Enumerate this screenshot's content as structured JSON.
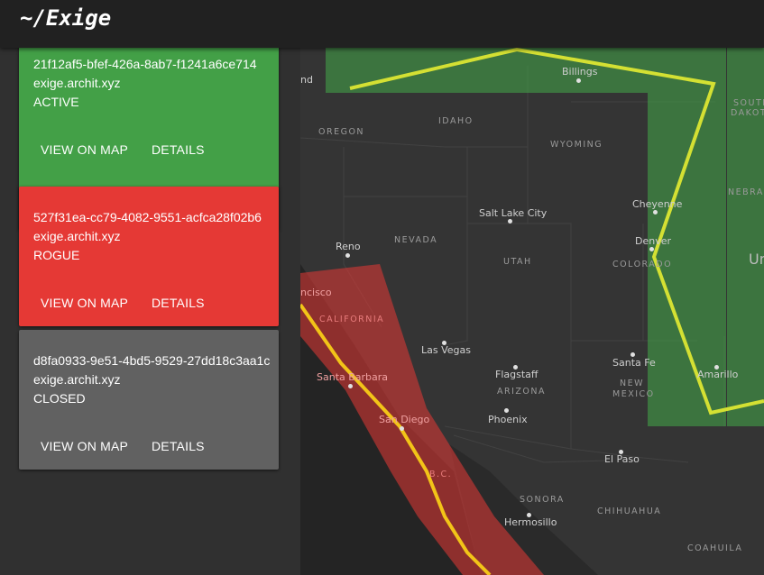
{
  "app": {
    "title": "~/Exige"
  },
  "colors": {
    "active": "#43a047",
    "rogue": "#e53935",
    "closed": "#616161",
    "route": "#e6e633"
  },
  "cards": [
    {
      "id": "21f12af5-bfef-426a-8ab7-f1241a6ce714",
      "host": "exige.archit.xyz",
      "status": "ACTIVE",
      "view_label": "VIEW ON MAP",
      "details_label": "DETAILS"
    },
    {
      "id": "527f31ea-cc79-4082-9551-acfca28f02b6",
      "host": "exige.archit.xyz",
      "status": "ROGUE",
      "view_label": "VIEW ON MAP",
      "details_label": "DETAILS"
    },
    {
      "id": "d8fa0933-9e51-4bd5-9529-27dd18c3aa1c",
      "host": "exige.archit.xyz",
      "status": "CLOSED",
      "view_label": "VIEW ON MAP",
      "details_label": "DETAILS"
    }
  ],
  "map": {
    "cities": [
      "Billings",
      "Salt Lake City",
      "Cheyenne",
      "Denver",
      "Reno",
      "Las Vegas",
      "Flagstaff",
      "Santa Fe",
      "Amarillo",
      "Santa Barbara",
      "San Diego",
      "Phoenix",
      "El Paso",
      "Hermosillo",
      "ncisco",
      "nd"
    ],
    "regions": [
      "IDAHO",
      "OREGON",
      "WYOMING",
      "NEVADA",
      "UTAH",
      "COLORADO",
      "CALIFORNIA",
      "ARIZONA",
      "NEW",
      "MEXICO",
      "SONORA",
      "CHIHUAHUA",
      "COAHUILA",
      "B.C.",
      "SOUTH",
      "DAKOT",
      "NEBRA",
      "Un"
    ]
  }
}
